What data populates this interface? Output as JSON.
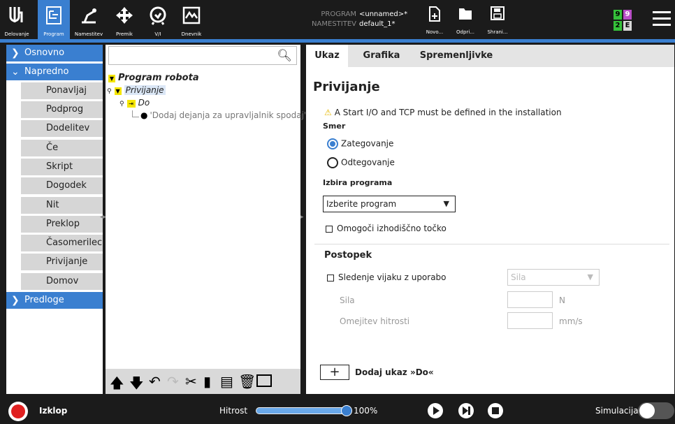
{
  "topbar": {
    "nav": [
      {
        "label": "Delovanje",
        "icon": "ur-logo-icon"
      },
      {
        "label": "Program",
        "icon": "program-tree-icon"
      },
      {
        "label": "Namestitev",
        "icon": "installation-robot-icon"
      },
      {
        "label": "Premik",
        "icon": "move-arrows-icon"
      },
      {
        "label": "V/I",
        "icon": "io-icon"
      },
      {
        "label": "Dnevnik",
        "icon": "log-icon"
      }
    ],
    "program_key": "PROGRAM",
    "program_value": "<unnamed>*",
    "installation_key": "NAMESTITEV",
    "installation_value": "default_1*",
    "file_buttons": [
      {
        "label": "Novo...",
        "icon": "new-file-icon"
      },
      {
        "label": "Odpri...",
        "icon": "open-folder-icon"
      },
      {
        "label": "Shrani...",
        "icon": "save-icon"
      }
    ],
    "speed_indicator": {
      "a": "9",
      "b": "9",
      "c": "2",
      "d": "E"
    },
    "colors": {
      "accent": "#3a7fd0",
      "green": "#35c13a",
      "purple": "#b94ec8"
    }
  },
  "left_panel": {
    "categories": [
      {
        "label": "Osnovno",
        "expanded": false
      },
      {
        "label": "Napredno",
        "expanded": true
      },
      {
        "label": "Predloge",
        "expanded": false
      }
    ],
    "advanced_items": [
      "Ponavljaj",
      "Podprog",
      "Dodelitev",
      "Če",
      "Skript",
      "Dogodek",
      "Nit",
      "Preklop",
      "Časomerilec",
      "Privijanje",
      "Domov"
    ]
  },
  "tree": {
    "search_placeholder": "",
    "root": "Program robota",
    "node1": "Privijanje",
    "node2": "Do",
    "node3": "'Dodaj dejanja za upravljalnik spodaj'"
  },
  "right_panel": {
    "tabs": [
      "Ukaz",
      "Grafika",
      "Spremenljivke"
    ],
    "title": "Privijanje",
    "warning": "A Start I/O and TCP must be defined in the installation",
    "direction_label": "Smer",
    "radio_tighten": "Zategovanje",
    "radio_loosen": "Odtegovanje",
    "program_select_label": "Izbira programa",
    "program_select_value": "Izberite program",
    "enable_start_label": "Omogoči izhodiščno točko",
    "procedure_label": "Postopek",
    "screw_follow_label": "Sledenje vijaku z uporabo",
    "screw_follow_select": "Sila",
    "force_label": "Sila",
    "force_unit": "N",
    "speed_limit_label": "Omejitev hitrosti",
    "speed_limit_unit": "mm/s",
    "add_button_symbol": "+",
    "add_label": "Dodaj ukaz »Do«"
  },
  "bottombar": {
    "power_label": "Izklop",
    "speed_label": "Hitrost",
    "speed_value": "100%",
    "speed_fraction": 1.0,
    "sim_label": "Simulacija"
  }
}
